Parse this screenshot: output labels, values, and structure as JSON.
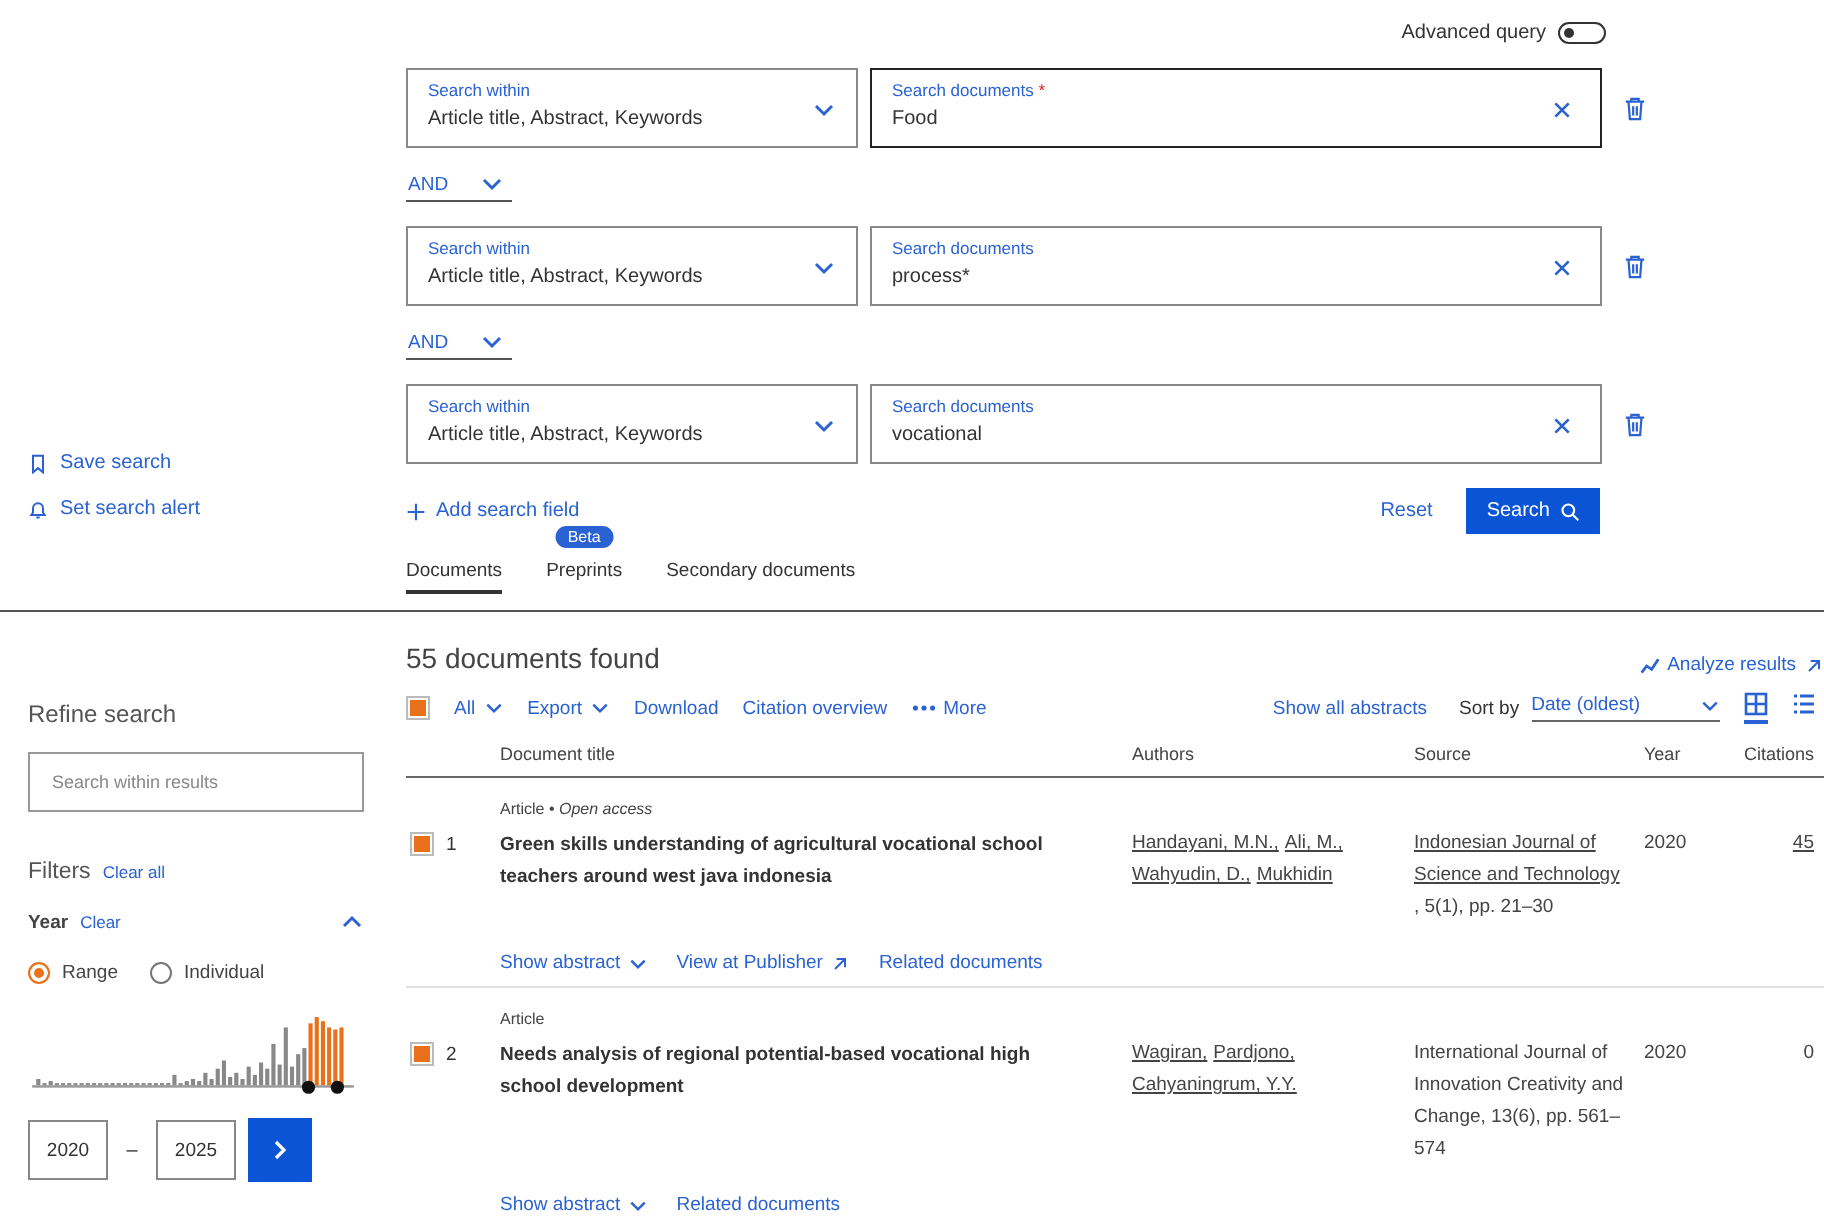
{
  "advanced_query": {
    "label": "Advanced query",
    "on": false
  },
  "search_rows": [
    {
      "within_label": "Search within",
      "within_value": "Article title, Abstract, Keywords",
      "doc_label": "Search documents",
      "required_mark": "*",
      "value": "Food"
    },
    {
      "within_label": "Search within",
      "within_value": "Article title, Abstract, Keywords",
      "doc_label": "Search documents",
      "value": "process*"
    },
    {
      "within_label": "Search within",
      "within_value": "Article title, Abstract, Keywords",
      "doc_label": "Search documents",
      "value": "vocational"
    }
  ],
  "operators": [
    "AND",
    "AND"
  ],
  "side_actions": [
    {
      "kind": "bookmark",
      "label": "Save search"
    },
    {
      "kind": "bell",
      "label": "Set search alert"
    }
  ],
  "add_field": "Add search field",
  "reset": "Reset",
  "search": "Search",
  "tabs": [
    {
      "label": "Documents",
      "selected": true
    },
    {
      "label": "Preprints",
      "selected": false,
      "badge": "Beta"
    },
    {
      "label": "Secondary documents",
      "selected": false
    }
  ],
  "sidebar": {
    "title": "Refine search",
    "placeholder": "Search within results",
    "filters": "Filters",
    "clear_all": "Clear all",
    "year": {
      "title": "Year",
      "clear": "Clear",
      "expanded": true,
      "modes": [
        {
          "label": "Range",
          "selected": true
        },
        {
          "label": "Individual",
          "selected": false
        }
      ],
      "from": "2020",
      "dash": "–",
      "to": "2025"
    }
  },
  "results": {
    "count": "55 documents found",
    "analyze": "Analyze results",
    "select_all_checked": true,
    "toolbar": [
      {
        "kind": "dropdown",
        "label": "All"
      },
      {
        "kind": "dropdown",
        "label": "Export"
      },
      {
        "kind": "plain",
        "label": "Download"
      },
      {
        "kind": "plain",
        "label": "Citation overview"
      },
      {
        "kind": "more",
        "label": "More"
      }
    ],
    "show_all": "Show all abstracts",
    "sort_label": "Sort by",
    "sort_value": "Date (oldest)",
    "views": [
      {
        "kind": "grid",
        "selected": true
      },
      {
        "kind": "list",
        "selected": false
      }
    ],
    "columns": [
      "Document title",
      "Authors",
      "Source",
      "Year",
      "Citations"
    ],
    "rows": [
      {
        "checked": true,
        "number": "1",
        "type": "Article • *Open access*",
        "title": "Green skills understanding of agricultural vocational school teachers around west java indonesia",
        "authors": [
          "Handayani, M.N.,",
          "Ali, M.,",
          "Wahyudin, D.,",
          "Mukhidin"
        ],
        "source_link": "Indonesian Journal of Science and Technology",
        "source_detail": ", 5(1), pp. 21–30",
        "year": "2020",
        "citations": "45",
        "citations_link": true,
        "actions": [
          {
            "kind": "dropdown",
            "label": "Show abstract"
          },
          {
            "kind": "external",
            "label": "View at Publisher"
          },
          {
            "kind": "plain",
            "label": "Related documents"
          }
        ]
      },
      {
        "checked": true,
        "number": "2",
        "type": "Article",
        "title": "Needs analysis of regional potential-based vocational high school development",
        "authors": [
          "Wagiran,",
          "Pardjono,",
          "Cahyaningrum, Y.Y."
        ],
        "source_detail": "International Journal of Innovation Creativity and Change, 13(6), pp. 561–574",
        "year": "2020",
        "citations": "0",
        "citations_link": false,
        "actions": [
          {
            "kind": "dropdown",
            "label": "Show abstract"
          },
          {
            "kind": "plain",
            "label": "Related documents"
          }
        ]
      }
    ]
  }
}
